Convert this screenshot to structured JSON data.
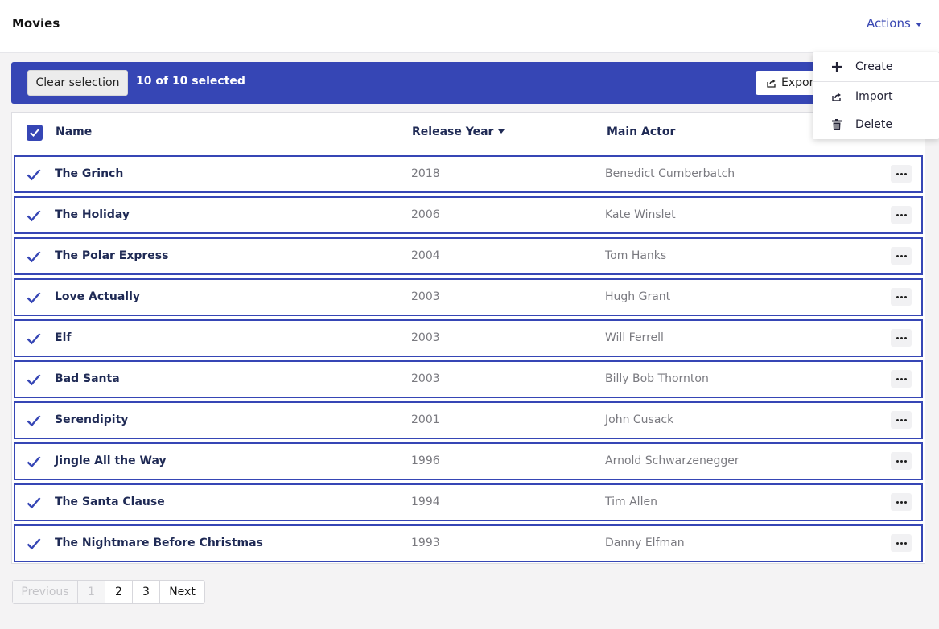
{
  "header": {
    "title": "Movies",
    "actions_label": "Actions"
  },
  "selection": {
    "clear_label": "Clear selection",
    "count_text": "10 of 10 selected",
    "export_label": "Export"
  },
  "actions_menu": {
    "items": [
      {
        "label": "Create",
        "icon": "plus-icon"
      },
      {
        "label": "Import",
        "icon": "import-icon"
      },
      {
        "label": "Delete",
        "icon": "trash-icon"
      }
    ]
  },
  "table": {
    "columns": [
      "Name",
      "Release Year",
      "Main Actor"
    ],
    "sort_column": "Release Year",
    "rows": [
      {
        "name": "The Grinch",
        "year": "2018",
        "actor": "Benedict Cumberbatch"
      },
      {
        "name": "The Holiday",
        "year": "2006",
        "actor": "Kate Winslet"
      },
      {
        "name": "The Polar Express",
        "year": "2004",
        "actor": "Tom Hanks"
      },
      {
        "name": "Love Actually",
        "year": "2003",
        "actor": "Hugh Grant"
      },
      {
        "name": "Elf",
        "year": "2003",
        "actor": "Will Ferrell"
      },
      {
        "name": "Bad Santa",
        "year": "2003",
        "actor": "Billy Bob Thornton"
      },
      {
        "name": "Serendipity",
        "year": "2001",
        "actor": "John Cusack"
      },
      {
        "name": "Jingle All the Way",
        "year": "1996",
        "actor": "Arnold Schwarzenegger"
      },
      {
        "name": "The Santa Clause",
        "year": "1994",
        "actor": "Tim Allen"
      },
      {
        "name": "The Nightmare Before Christmas",
        "year": "1993",
        "actor": "Danny Elfman"
      }
    ]
  },
  "pagination": {
    "previous": "Previous",
    "pages": [
      "1",
      "2",
      "3"
    ],
    "current": "1",
    "next": "Next"
  },
  "colors": {
    "accent": "#3646b5",
    "link": "#3947b2"
  }
}
